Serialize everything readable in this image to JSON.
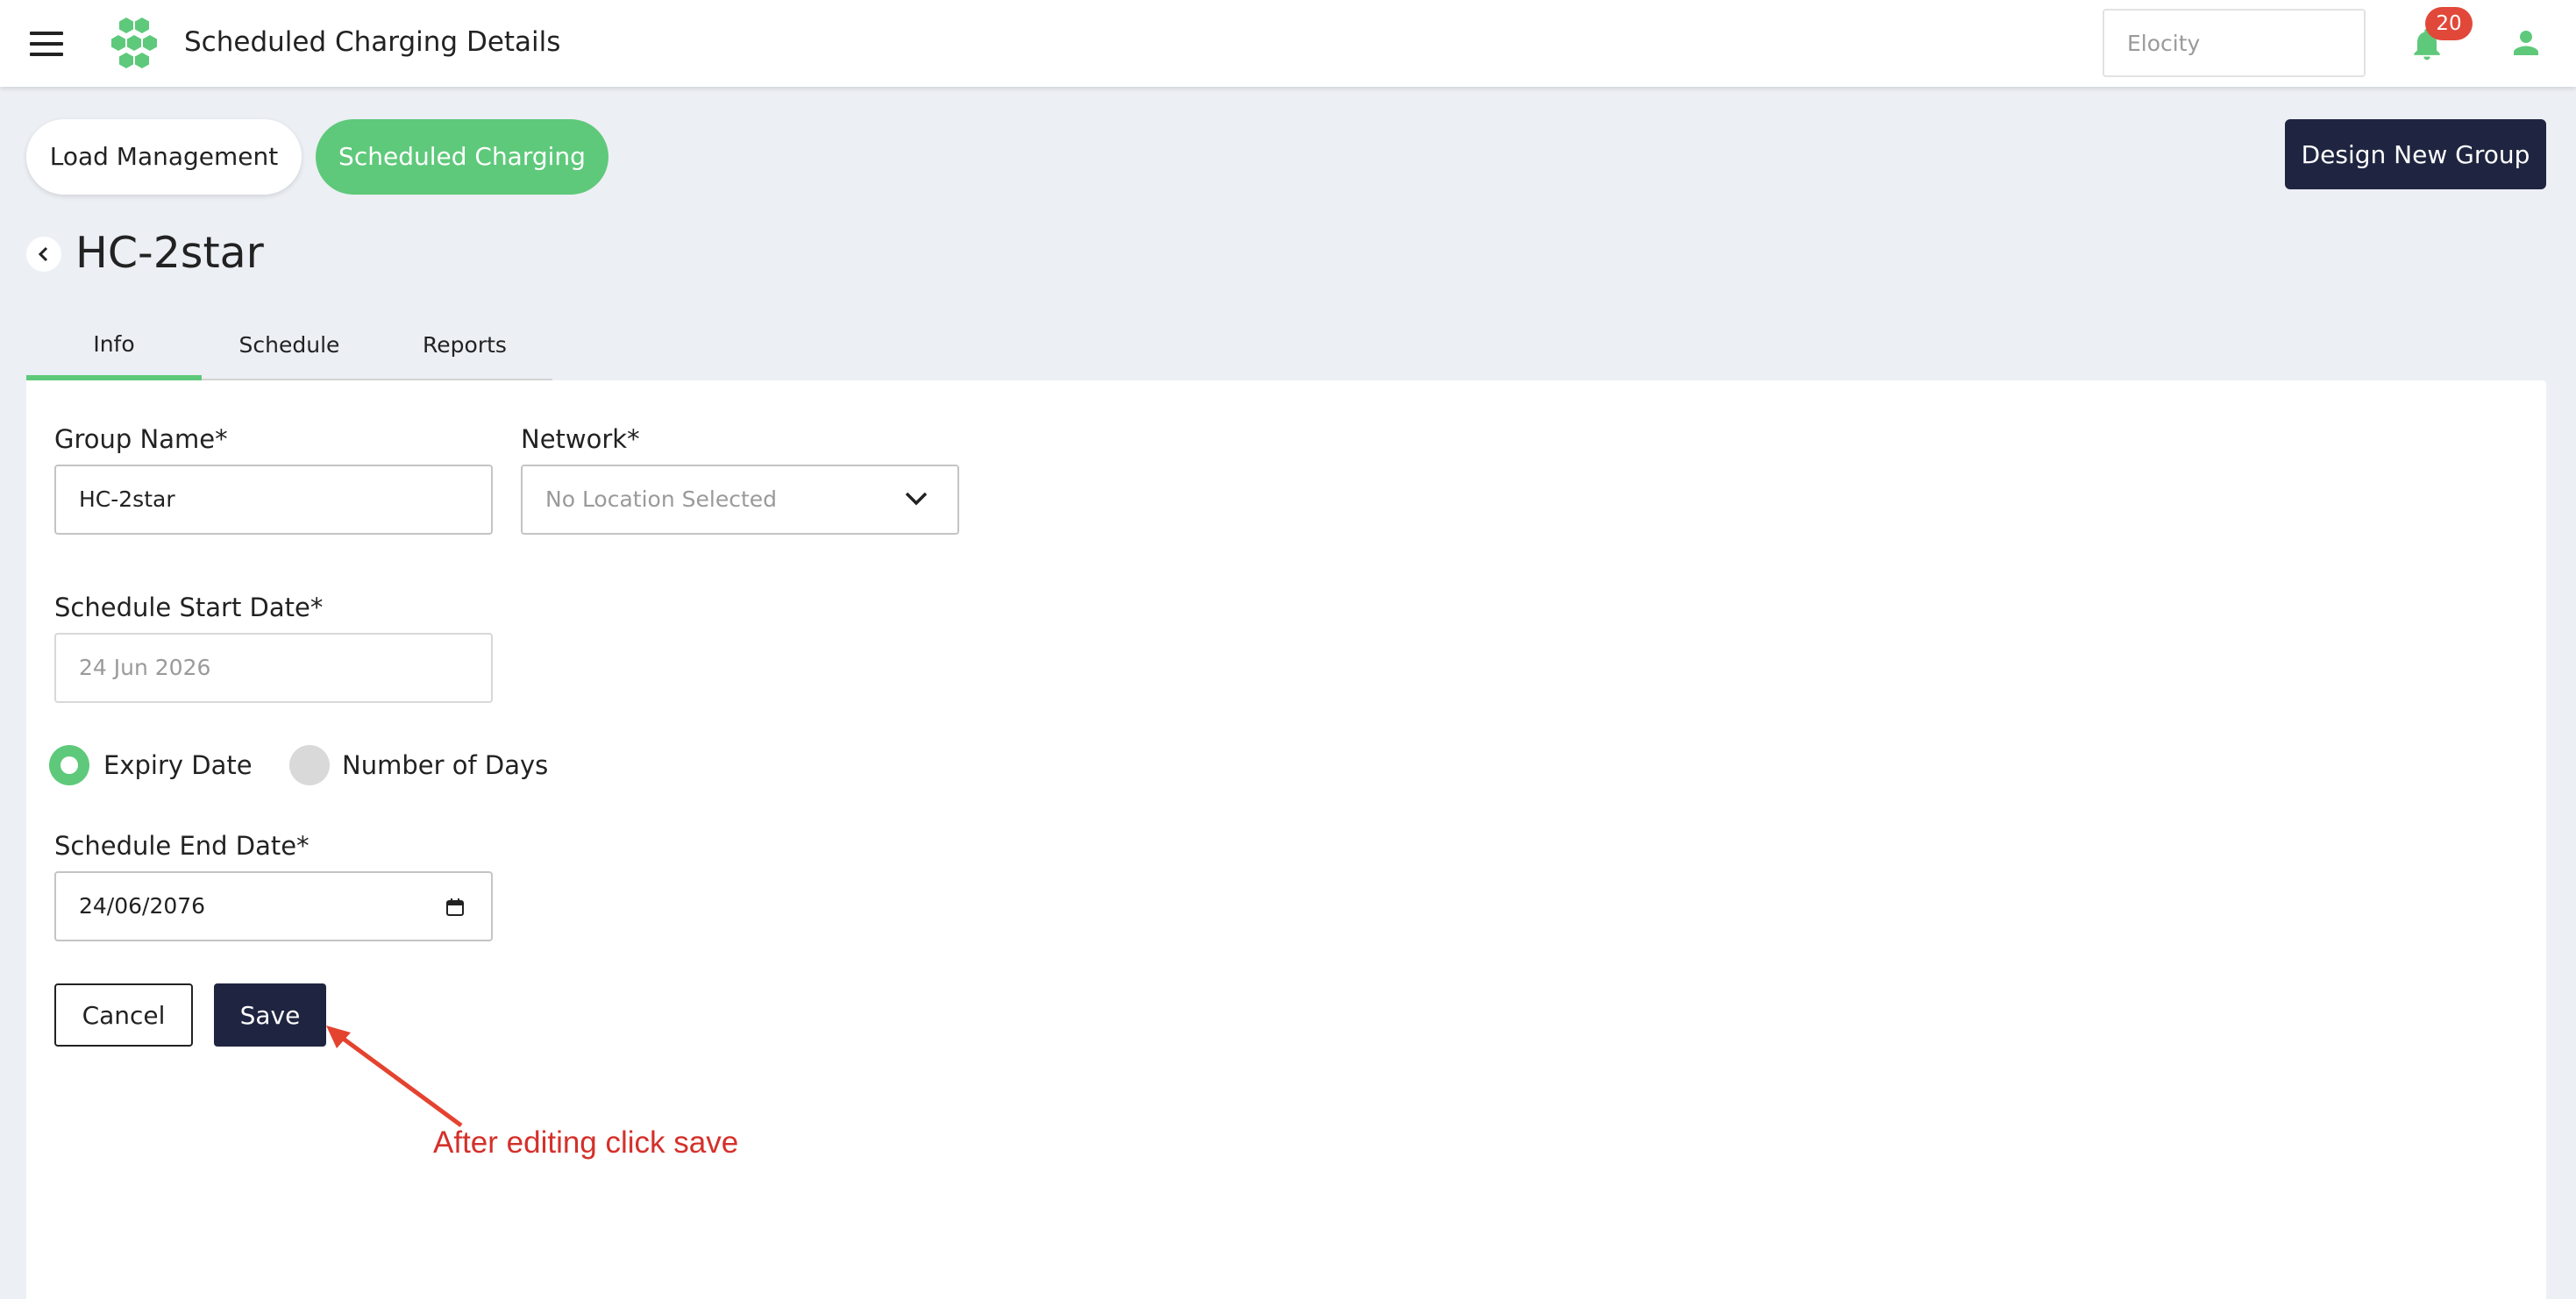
{
  "topbar": {
    "title": "Scheduled Charging Details",
    "org_placeholder": "Elocity",
    "notification_count": "20",
    "icons": [
      "menu-icon",
      "logo-icon",
      "bell-icon",
      "user-icon"
    ]
  },
  "header": {
    "tabs": [
      {
        "label": "Load Management",
        "active": false
      },
      {
        "label": "Scheduled Charging",
        "active": true
      }
    ],
    "design_button": "Design New Group"
  },
  "page": {
    "title": "HC-2star"
  },
  "subtabs": [
    {
      "label": "Info",
      "active": true
    },
    {
      "label": "Schedule",
      "active": false
    },
    {
      "label": "Reports",
      "active": false
    }
  ],
  "form": {
    "group_name_label": "Group Name*",
    "group_name_value": "HC-2star",
    "network_label": "Network*",
    "network_placeholder": "No Location Selected",
    "start_date_label": "Schedule Start Date*",
    "start_date_value": "24 Jun 2026",
    "radio_expiry": "Expiry Date",
    "radio_days": "Number of Days",
    "selected_radio": "Expiry Date",
    "end_date_label": "Schedule End Date*",
    "end_date_value": "24/06/2076",
    "cancel_label": "Cancel",
    "save_label": "Save"
  },
  "annotation": {
    "text": "After editing click save",
    "color": "#d4302a"
  },
  "colors": {
    "accent": "#5ec97a",
    "navy": "#1f2540",
    "badge": "#e1483a",
    "background": "#eceff4"
  }
}
